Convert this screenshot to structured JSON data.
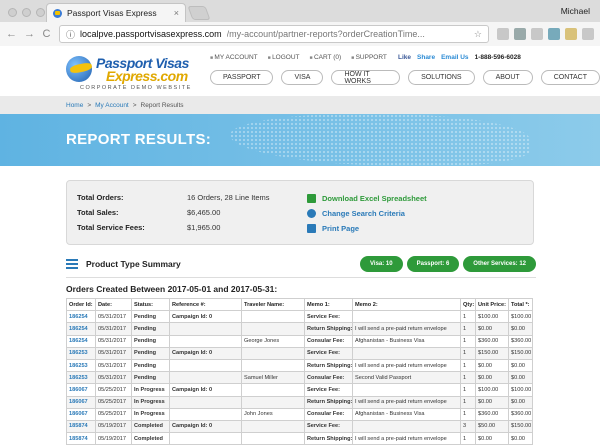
{
  "browser": {
    "tab_title": "Passport Visas Express",
    "tab_close": "×",
    "user": "Michael",
    "url_host": "localpve.passportvisasexpress.com",
    "url_rest": "/my-account/partner-reports?orderCreationTime...",
    "back": "←",
    "forward": "→",
    "reload": "C",
    "star": "☆"
  },
  "site": {
    "logo_line1": "Passport Visas",
    "logo_line2": "Express.com",
    "logo_sub": "CORPORATE DEMO WEBSITE",
    "toplinks": [
      "MY ACCOUNT",
      "LOGOUT",
      "CART (0)",
      "SUPPORT"
    ],
    "social": {
      "like": "Like",
      "share": "Share",
      "email": "Email Us",
      "phone": "1-888-596-6028"
    },
    "nav": [
      "PASSPORT",
      "VISA",
      "HOW IT WORKS",
      "SOLUTIONS",
      "ABOUT",
      "CONTACT"
    ]
  },
  "breadcrumb": [
    "Home",
    "My Account",
    "Report Results"
  ],
  "breadcrumb_sep": ">",
  "banner_title": "REPORT RESULTS:",
  "summary": {
    "total_orders_label": "Total Orders:",
    "total_orders_value": "16 Orders, 28 Line Items",
    "total_sales_label": "Total Sales:",
    "total_sales_value": "$6,465.00",
    "total_fees_label": "Total Service Fees:",
    "total_fees_value": "$1,965.00",
    "download": "Download Excel Spreadsheet",
    "change": "Change Search Criteria",
    "print": "Print Page"
  },
  "product_summary": {
    "title": "Product Type Summary",
    "pills": [
      "Visa: 10",
      "Passport: 6",
      "Other Services: 12"
    ]
  },
  "orders_title": "Orders Created Between 2017-05-01 and 2017-05-31:",
  "table": {
    "headers": [
      "Order Id:",
      "Date:",
      "Status:",
      "Reference #:",
      "Traveler Name:",
      "Memo 1:",
      "Memo 2:",
      "Qty:",
      "Unit Price:",
      "Total *:"
    ],
    "rows": [
      [
        "186254",
        "05/31/2017",
        "Pending",
        "Campaign Id: 0",
        "",
        "Service Fee:",
        "",
        "1",
        "$100.00",
        "$100.00"
      ],
      [
        "186254",
        "05/31/2017",
        "Pending",
        "",
        "",
        "Return Shipping:",
        "I will send a pre-paid return envelope",
        "1",
        "$0.00",
        "$0.00"
      ],
      [
        "186254",
        "05/31/2017",
        "Pending",
        "",
        "George Jones",
        "Consular Fee:",
        "Afghanistan - Business Visa",
        "1",
        "$360.00",
        "$360.00"
      ],
      [
        "186253",
        "05/31/2017",
        "Pending",
        "Campaign Id: 0",
        "",
        "Service Fee:",
        "",
        "1",
        "$150.00",
        "$150.00"
      ],
      [
        "186253",
        "05/31/2017",
        "Pending",
        "",
        "",
        "Return Shipping:",
        "I will send a pre-paid return envelope",
        "1",
        "$0.00",
        "$0.00"
      ],
      [
        "186253",
        "05/31/2017",
        "Pending",
        "",
        "Samuel Miller",
        "Consular Fee:",
        "Second Valid Passport",
        "1",
        "$0.00",
        "$0.00"
      ],
      [
        "186067",
        "05/25/2017",
        "In Progress",
        "Campaign Id: 0",
        "",
        "Service Fee:",
        "",
        "1",
        "$100.00",
        "$100.00"
      ],
      [
        "186067",
        "05/25/2017",
        "In Progress",
        "",
        "",
        "Return Shipping:",
        "I will send a pre-paid return envelope",
        "1",
        "$0.00",
        "$0.00"
      ],
      [
        "186067",
        "05/25/2017",
        "In Progress",
        "",
        "John Jones",
        "Consular Fee:",
        "Afghanistan - Business Visa",
        "1",
        "$360.00",
        "$360.00"
      ],
      [
        "185874",
        "05/19/2017",
        "Completed",
        "Campaign Id: 0",
        "",
        "Service Fee:",
        "",
        "3",
        "$50.00",
        "$150.00"
      ],
      [
        "185874",
        "05/19/2017",
        "Completed",
        "",
        "",
        "Return Shipping:",
        "I will send a pre-paid return envelope",
        "1",
        "$0.00",
        "$0.00"
      ]
    ]
  },
  "colors": {
    "link": "#2a7ab8",
    "green": "#2e9a3a",
    "banner": "#6cbbe6"
  }
}
